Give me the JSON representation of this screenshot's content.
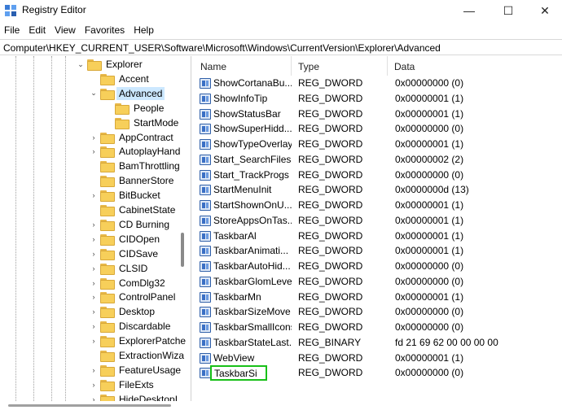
{
  "window": {
    "title": "Registry Editor",
    "controls": {
      "minimize": "—",
      "maximize": "☐",
      "close": "✕"
    }
  },
  "menu": [
    "File",
    "Edit",
    "View",
    "Favorites",
    "Help"
  ],
  "address": "Computer\\HKEY_CURRENT_USER\\Software\\Microsoft\\Windows\\CurrentVersion\\Explorer\\Advanced",
  "tree": {
    "items": [
      {
        "label": "Explorer",
        "expander": "⌄"
      },
      {
        "label": "Accent",
        "expander": ""
      },
      {
        "label": "Advanced",
        "expander": "⌄",
        "selected": true
      },
      {
        "label": "People",
        "expander": ""
      },
      {
        "label": "StartMode",
        "expander": ""
      },
      {
        "label": "AppContract",
        "expander": "›"
      },
      {
        "label": "AutoplayHand",
        "expander": "›"
      },
      {
        "label": "BamThrottling",
        "expander": ""
      },
      {
        "label": "BannerStore",
        "expander": ""
      },
      {
        "label": "BitBucket",
        "expander": "›"
      },
      {
        "label": "CabinetState",
        "expander": ""
      },
      {
        "label": "CD Burning",
        "expander": "›"
      },
      {
        "label": "CIDOpen",
        "expander": "›"
      },
      {
        "label": "CIDSave",
        "expander": "›"
      },
      {
        "label": "CLSID",
        "expander": "›"
      },
      {
        "label": "ComDlg32",
        "expander": "›"
      },
      {
        "label": "ControlPanel",
        "expander": "›"
      },
      {
        "label": "Desktop",
        "expander": "›"
      },
      {
        "label": "Discardable",
        "expander": "›"
      },
      {
        "label": "ExplorerPatche",
        "expander": "›"
      },
      {
        "label": "ExtractionWiza",
        "expander": ""
      },
      {
        "label": "FeatureUsage",
        "expander": "›"
      },
      {
        "label": "FileExts",
        "expander": "›"
      },
      {
        "label": "HideDesktopI",
        "expander": "›"
      }
    ]
  },
  "values_pane": {
    "headers": {
      "name": "Name",
      "type": "Type",
      "data": "Data"
    },
    "rows": [
      {
        "name": "ShowCortanaBu...",
        "type": "REG_DWORD",
        "data": "0x00000000 (0)"
      },
      {
        "name": "ShowInfoTip",
        "type": "REG_DWORD",
        "data": "0x00000001 (1)"
      },
      {
        "name": "ShowStatusBar",
        "type": "REG_DWORD",
        "data": "0x00000001 (1)"
      },
      {
        "name": "ShowSuperHidd...",
        "type": "REG_DWORD",
        "data": "0x00000000 (0)"
      },
      {
        "name": "ShowTypeOverlay",
        "type": "REG_DWORD",
        "data": "0x00000001 (1)"
      },
      {
        "name": "Start_SearchFiles",
        "type": "REG_DWORD",
        "data": "0x00000002 (2)"
      },
      {
        "name": "Start_TrackProgs",
        "type": "REG_DWORD",
        "data": "0x00000000 (0)"
      },
      {
        "name": "StartMenuInit",
        "type": "REG_DWORD",
        "data": "0x0000000d (13)"
      },
      {
        "name": "StartShownOnU...",
        "type": "REG_DWORD",
        "data": "0x00000001 (1)"
      },
      {
        "name": "StoreAppsOnTas...",
        "type": "REG_DWORD",
        "data": "0x00000001 (1)"
      },
      {
        "name": "TaskbarAl",
        "type": "REG_DWORD",
        "data": "0x00000001 (1)"
      },
      {
        "name": "TaskbarAnimati...",
        "type": "REG_DWORD",
        "data": "0x00000001 (1)"
      },
      {
        "name": "TaskbarAutoHid...",
        "type": "REG_DWORD",
        "data": "0x00000000 (0)"
      },
      {
        "name": "TaskbarGlomLevel",
        "type": "REG_DWORD",
        "data": "0x00000000 (0)"
      },
      {
        "name": "TaskbarMn",
        "type": "REG_DWORD",
        "data": "0x00000001 (1)"
      },
      {
        "name": "TaskbarSizeMove",
        "type": "REG_DWORD",
        "data": "0x00000000 (0)"
      },
      {
        "name": "TaskbarSmallIcons",
        "type": "REG_DWORD",
        "data": "0x00000000 (0)"
      },
      {
        "name": "TaskbarStateLast...",
        "type": "REG_BINARY",
        "data": "fd 21 69 62 00 00 00 00"
      },
      {
        "name": "WebView",
        "type": "REG_DWORD",
        "data": "0x00000001 (1)"
      },
      {
        "name": "TaskbarSi",
        "type": "REG_DWORD",
        "data": "0x00000000 (0)",
        "editing": true
      }
    ]
  },
  "colors": {
    "selection": "#cce8ff",
    "edit_border": "#18c018",
    "folder": "#f7cf5a"
  }
}
